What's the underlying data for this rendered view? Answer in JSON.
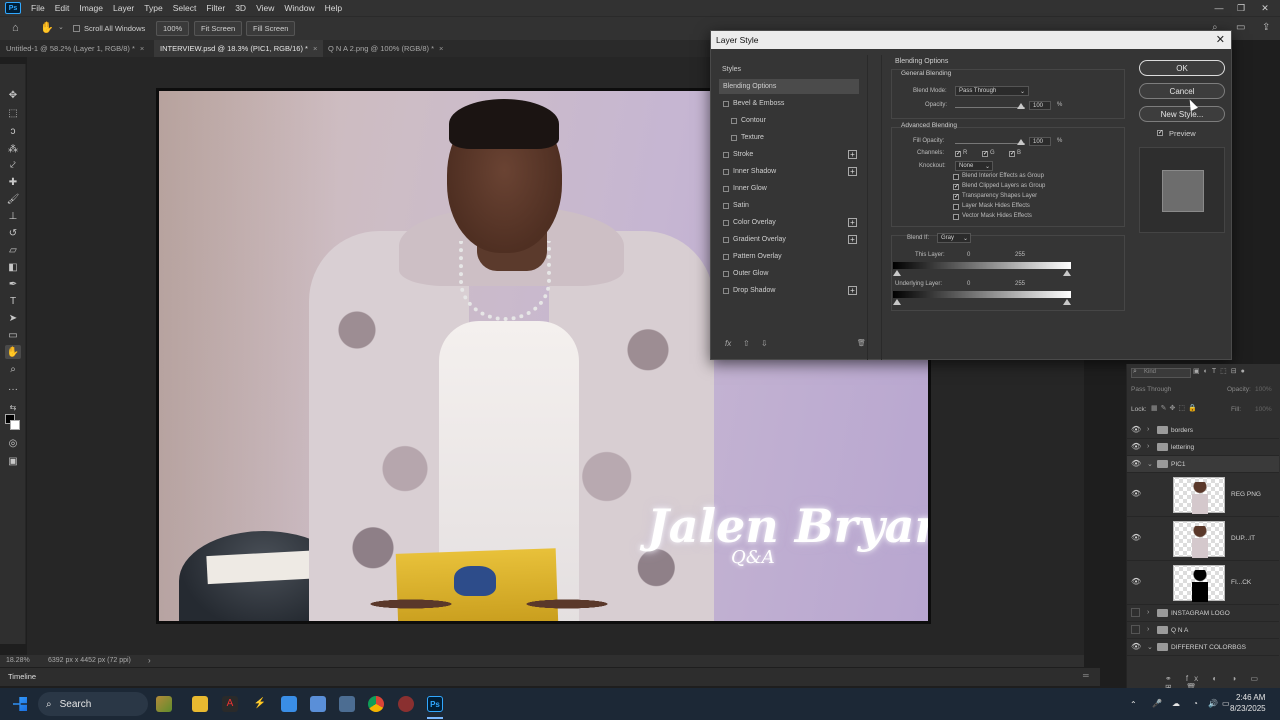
{
  "app": {
    "logo": "Ps",
    "menu": [
      "File",
      "Edit",
      "Image",
      "Layer",
      "Type",
      "Select",
      "Filter",
      "3D",
      "View",
      "Window",
      "Help"
    ],
    "window_controls": [
      "—",
      "❐",
      "✕"
    ]
  },
  "options_bar": {
    "scroll_all_windows": "Scroll All Windows",
    "zoom": "100%",
    "fit_screen": "Fit Screen",
    "fill_screen": "Fill Screen"
  },
  "tabs": [
    {
      "label": "Untitled-1 @ 58.2% (Layer 1, RGB/8) *",
      "active": false
    },
    {
      "label": "INTERVIEW.psd @ 18.3% (PIC1, RGB/16) *",
      "active": true
    },
    {
      "label": "Q N A 2.png @ 100% (RGB/8) *",
      "active": false
    }
  ],
  "tab_close": "×",
  "toolbar_icons": [
    "move-icon",
    "marquee-icon",
    "lasso-icon",
    "quick-select-icon",
    "eyedropper-icon",
    "healing-icon",
    "brush-icon",
    "stamp-icon",
    "history-brush-icon",
    "eraser-icon",
    "gradient-icon",
    "pen-icon",
    "type-icon",
    "path-select-icon",
    "shape-icon",
    "hand-icon",
    "zoom-icon",
    "more-icon"
  ],
  "canvas": {
    "title_text": "Jalen Bryant",
    "subtitle_text": "Q&A"
  },
  "status": {
    "zoom": "18.28%",
    "doc_size": "6392 px x 4452 px (72 ppi)",
    "arrow": "›"
  },
  "timeline": {
    "label": "Timeline",
    "collapse": "═"
  },
  "dialog": {
    "title": "Layer Style",
    "close": "✕",
    "styles_header": "Styles",
    "styles": [
      {
        "label": "Blending Options",
        "checkbox": false,
        "plus": false,
        "selected": true,
        "indent": false
      },
      {
        "label": "Bevel & Emboss",
        "checkbox": true,
        "plus": false,
        "selected": false,
        "indent": false
      },
      {
        "label": "Contour",
        "checkbox": true,
        "plus": false,
        "selected": false,
        "indent": true
      },
      {
        "label": "Texture",
        "checkbox": true,
        "plus": false,
        "selected": false,
        "indent": true
      },
      {
        "label": "Stroke",
        "checkbox": true,
        "plus": true,
        "selected": false,
        "indent": false
      },
      {
        "label": "Inner Shadow",
        "checkbox": true,
        "plus": true,
        "selected": false,
        "indent": false
      },
      {
        "label": "Inner Glow",
        "checkbox": true,
        "plus": false,
        "selected": false,
        "indent": false
      },
      {
        "label": "Satin",
        "checkbox": true,
        "plus": false,
        "selected": false,
        "indent": false
      },
      {
        "label": "Color Overlay",
        "checkbox": true,
        "plus": true,
        "selected": false,
        "indent": false
      },
      {
        "label": "Gradient Overlay",
        "checkbox": true,
        "plus": true,
        "selected": false,
        "indent": false
      },
      {
        "label": "Pattern Overlay",
        "checkbox": true,
        "plus": false,
        "selected": false,
        "indent": false
      },
      {
        "label": "Outer Glow",
        "checkbox": true,
        "plus": false,
        "selected": false,
        "indent": false
      },
      {
        "label": "Drop Shadow",
        "checkbox": true,
        "plus": true,
        "selected": false,
        "indent": false
      }
    ],
    "fx_bar": {
      "fx": "fx",
      "up": "⇧",
      "down": "⇩",
      "trash": "🗑"
    },
    "blending_options": {
      "section_title": "Blending Options",
      "general_title": "General Blending",
      "blend_mode_label": "Blend Mode:",
      "blend_mode_value": "Pass Through",
      "opacity_label": "Opacity:",
      "opacity_value": "100",
      "percent": "%",
      "advanced_title": "Advanced Blending",
      "fill_opacity_label": "Fill Opacity:",
      "fill_opacity_value": "100",
      "channels_label": "Channels:",
      "channels": [
        "R",
        "G",
        "B"
      ],
      "knockout_label": "Knockout:",
      "knockout_value": "None",
      "checkboxes": [
        {
          "label": "Blend Interior Effects as Group",
          "checked": false
        },
        {
          "label": "Blend Clipped Layers as Group",
          "checked": true
        },
        {
          "label": "Transparency Shapes Layer",
          "checked": true
        },
        {
          "label": "Layer Mask Hides Effects",
          "checked": false
        },
        {
          "label": "Vector Mask Hides Effects",
          "checked": false
        }
      ],
      "blend_if_label": "Blend If:",
      "blend_if_value": "Gray",
      "this_layer_label": "This Layer:",
      "this_layer_min": "0",
      "this_layer_max": "255",
      "underlying_label": "Underlying Layer:",
      "underlying_min": "0",
      "underlying_max": "255",
      "check_mark": "✓"
    },
    "buttons": {
      "ok": "OK",
      "cancel": "Cancel",
      "new_style": "New Style...",
      "preview": "Preview"
    }
  },
  "layers_panel": {
    "search_placeholder": "Kind",
    "blend_mode": "Pass Through",
    "opacity_label": "Opacity:",
    "opacity_value": "100%",
    "lock_label": "Lock:",
    "fill_label": "Fill:",
    "fill_value": "100%",
    "eye": "👁",
    "layers": [
      {
        "name": "borders",
        "type": "group",
        "visible": true
      },
      {
        "name": "lettering",
        "type": "group",
        "visible": true
      },
      {
        "name": "PIC1",
        "type": "group",
        "visible": true
      },
      {
        "name": "REG PNG",
        "type": "layer",
        "visible": true
      },
      {
        "name": "DUP...IT",
        "type": "layer",
        "visible": true
      },
      {
        "name": "FI...CK",
        "type": "layer-black",
        "visible": true
      },
      {
        "name": "INSTAGRAM LOGO",
        "type": "group",
        "visible": false
      },
      {
        "name": "Q N A",
        "type": "group",
        "visible": false
      },
      {
        "name": "DIFFERENT COLORBGS",
        "type": "group",
        "visible": true
      }
    ]
  },
  "taskbar": {
    "search_label": "Search",
    "time": "2:46 AM",
    "date": "8/23/2025"
  }
}
